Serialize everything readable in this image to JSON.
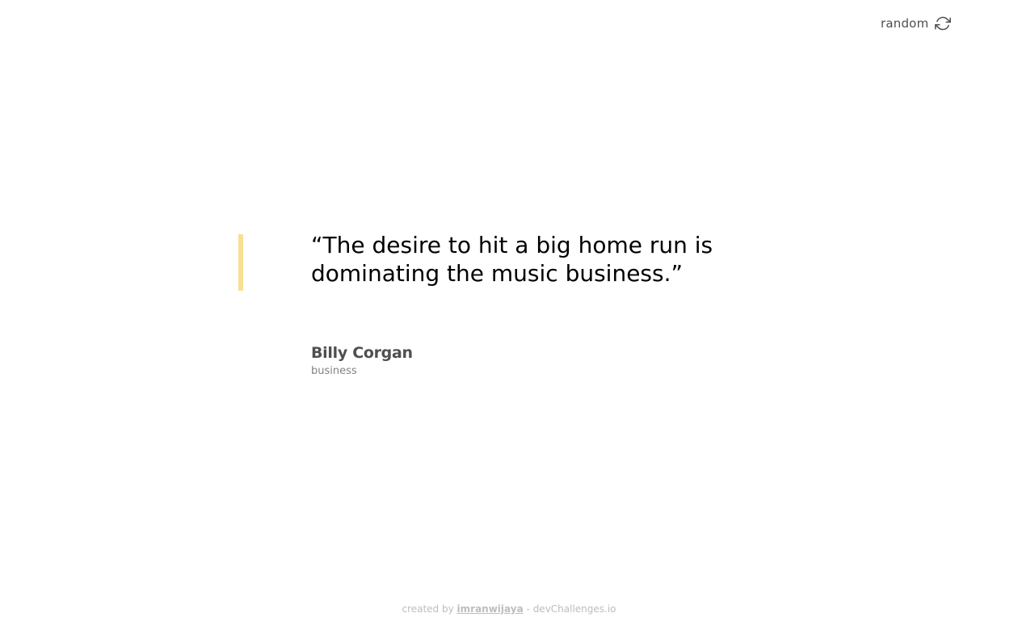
{
  "header": {
    "random_label": "random",
    "random_icon": "refresh-icon"
  },
  "quote": {
    "text": "“The desire to hit a big home run is dominating the music business.”",
    "accent_color": "#F7DF94"
  },
  "author": {
    "name": "Billy Corgan",
    "genre": "business"
  },
  "footer": {
    "prefix": "created by",
    "username": "imranwijaya",
    "separator": "-",
    "site": "devChallenges.io"
  }
}
